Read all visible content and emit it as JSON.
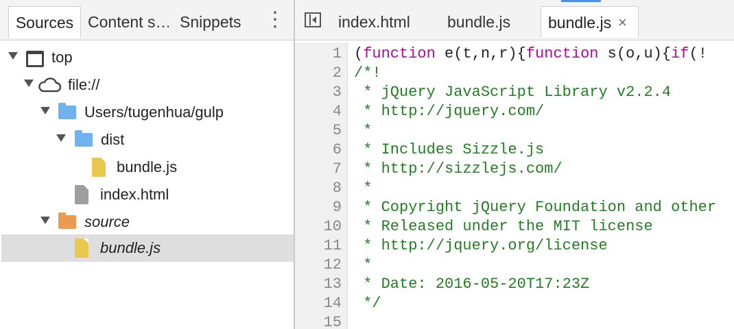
{
  "sidebar": {
    "tabs": {
      "sources": "Sources",
      "content_scripts": "Content s…",
      "snippets": "Snippets"
    },
    "menu_glyph": "⋮",
    "tree": [
      {
        "label": "top",
        "icon": "frame-icon"
      },
      {
        "label": "file://",
        "icon": "cloud-icon"
      },
      {
        "label": "Users/tugenhua/gulp",
        "icon": "folder-icon"
      },
      {
        "label": "dist",
        "icon": "folder-icon"
      },
      {
        "label": "bundle.js",
        "icon": "file-icon"
      },
      {
        "label": "index.html",
        "icon": "file-icon"
      },
      {
        "label": "source",
        "icon": "folder-icon"
      },
      {
        "label": "bundle.js",
        "icon": "file-icon",
        "selected": true
      }
    ]
  },
  "editor": {
    "tabs": [
      {
        "label": "index.html"
      },
      {
        "label": "bundle.js"
      },
      {
        "label": "bundle.js",
        "active": true,
        "close_glyph": "×"
      }
    ],
    "line_numbers": [
      "1",
      "2",
      "3",
      "4",
      "5",
      "6",
      "7",
      "8",
      "9",
      "10",
      "11",
      "12",
      "13",
      "14",
      "15"
    ],
    "line1": {
      "p1": "(",
      "kw1": "function",
      "p2": " e(t,n,r){",
      "kw2": "function",
      "p3": " s(o,u){",
      "kw3": "if",
      "p4": "(!"
    },
    "comment_lines": [
      "/*!",
      " * jQuery JavaScript Library v2.2.4",
      " * http://jquery.com/",
      " *",
      " * Includes Sizzle.js",
      " * http://sizzlejs.com/",
      " *",
      " * Copyright jQuery Foundation and other",
      " * Released under the MIT license",
      " * http://jquery.org/license",
      " *",
      " * Date: 2016-05-20T17:23Z",
      " */"
    ]
  },
  "colors": {
    "keyword": "#aa0d91",
    "comment": "#227e22",
    "folder_blue": "#6fb2ee",
    "folder_orange": "#ec9a50",
    "file_js": "#e9c84d",
    "file_html": "#9e9e9e",
    "accent": "#4c8fe5"
  }
}
